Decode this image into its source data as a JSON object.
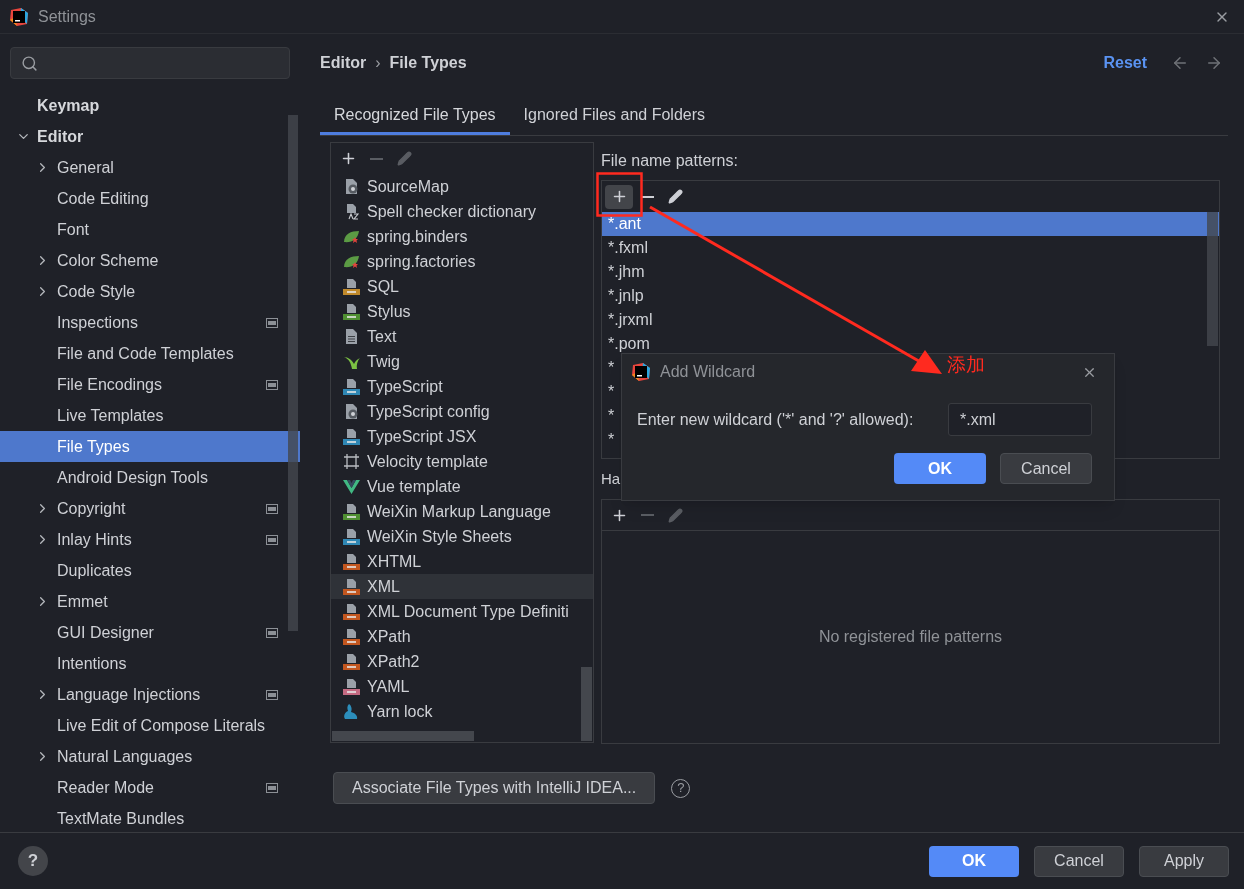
{
  "window": {
    "title": "Settings"
  },
  "sidebar": {
    "items": [
      {
        "label": "Keymap",
        "selected": false
      },
      {
        "label": "Editor",
        "selected": false,
        "expanded": true,
        "children": [
          {
            "label": "General",
            "expanded": false,
            "project": false,
            "selected": false
          },
          {
            "label": "Code Editing",
            "project": false,
            "selected": false
          },
          {
            "label": "Font",
            "project": false,
            "selected": false
          },
          {
            "label": "Color Scheme",
            "expanded": false,
            "project": false,
            "selected": false
          },
          {
            "label": "Code Style",
            "expanded": false,
            "project": false,
            "selected": false
          },
          {
            "label": "Inspections",
            "project": true,
            "selected": false
          },
          {
            "label": "File and Code Templates",
            "project": false,
            "selected": false
          },
          {
            "label": "File Encodings",
            "project": true,
            "selected": false
          },
          {
            "label": "Live Templates",
            "project": false,
            "selected": false
          },
          {
            "label": "File Types",
            "project": false,
            "selected": true
          },
          {
            "label": "Android Design Tools",
            "project": false,
            "selected": false
          },
          {
            "label": "Copyright",
            "expanded": false,
            "project": true,
            "selected": false
          },
          {
            "label": "Inlay Hints",
            "expanded": false,
            "project": true,
            "selected": false
          },
          {
            "label": "Duplicates",
            "project": false,
            "selected": false
          },
          {
            "label": "Emmet",
            "expanded": false,
            "project": false,
            "selected": false
          },
          {
            "label": "GUI Designer",
            "project": true,
            "selected": false
          },
          {
            "label": "Intentions",
            "project": false,
            "selected": false
          },
          {
            "label": "Language Injections",
            "expanded": false,
            "project": true,
            "selected": false
          },
          {
            "label": "Live Edit of Compose Literals",
            "project": false,
            "selected": false
          },
          {
            "label": "Natural Languages",
            "expanded": false,
            "project": false,
            "selected": false
          },
          {
            "label": "Reader Mode",
            "project": true,
            "selected": false
          },
          {
            "label": "TextMate Bundles",
            "project": false,
            "selected": false
          }
        ]
      }
    ]
  },
  "breadcrumb": {
    "items": [
      "Editor",
      "File Types"
    ],
    "separator": "›"
  },
  "reset": "Reset",
  "tabs": [
    {
      "label": "Recognized File Types",
      "selected": true
    },
    {
      "label": "Ignored Files and Folders",
      "selected": false
    }
  ],
  "file_types": {
    "toolbar": [
      {
        "kind": "add",
        "disabled": false
      },
      {
        "kind": "remove",
        "disabled": true
      },
      {
        "kind": "edit",
        "disabled": true
      }
    ],
    "items": [
      {
        "label": "SourceMap",
        "kind": "config",
        "selected": false
      },
      {
        "label": "Spell checker dictionary",
        "kind": "dictionary",
        "selected": false
      },
      {
        "label": "spring.binders",
        "kind": "leaf-gear",
        "selected": false
      },
      {
        "label": "spring.factories",
        "kind": "leaf-star",
        "selected": false
      },
      {
        "label": "SQL",
        "kind": "badge",
        "color": "#c0892b",
        "selected": false
      },
      {
        "label": "Stylus",
        "kind": "badge",
        "color": "#4f8f32",
        "selected": false
      },
      {
        "label": "Text",
        "kind": "text",
        "selected": false
      },
      {
        "label": "Twig",
        "kind": "twig",
        "selected": false
      },
      {
        "label": "TypeScript",
        "kind": "badge",
        "color": "#2f87b4",
        "selected": false
      },
      {
        "label": "TypeScript config",
        "kind": "config",
        "selected": false
      },
      {
        "label": "TypeScript JSX",
        "kind": "badge",
        "color": "#2f87b4",
        "selected": false
      },
      {
        "label": "Velocity template",
        "kind": "velocity",
        "selected": false
      },
      {
        "label": "Vue template",
        "kind": "vue",
        "selected": false
      },
      {
        "label": "WeiXin Markup Language",
        "kind": "badge",
        "color": "#4f8f32",
        "selected": false
      },
      {
        "label": "WeiXin Style Sheets",
        "kind": "badge",
        "color": "#2f87b4",
        "selected": false
      },
      {
        "label": "XHTML",
        "kind": "badge",
        "color": "#c2561f",
        "selected": false
      },
      {
        "label": "XML",
        "kind": "badge",
        "color": "#c2561f",
        "selected": true
      },
      {
        "label": "XML Document Type Definiti",
        "kind": "badge",
        "color": "#c2561f",
        "selected": false
      },
      {
        "label": "XPath",
        "kind": "badge",
        "color": "#c2561f",
        "selected": false
      },
      {
        "label": "XPath2",
        "kind": "badge",
        "color": "#c2561f",
        "selected": false
      },
      {
        "label": "YAML",
        "kind": "badge",
        "color": "#c46a82",
        "selected": false
      },
      {
        "label": "Yarn lock",
        "kind": "yarn",
        "selected": false
      }
    ]
  },
  "patterns": {
    "label": "File name patterns:",
    "toolbar": [
      {
        "kind": "add",
        "disabled": false,
        "highlighted": true
      },
      {
        "kind": "remove",
        "disabled": false,
        "highlighted": false
      },
      {
        "kind": "edit",
        "disabled": false,
        "highlighted": false
      }
    ],
    "items": [
      {
        "text": "*.ant",
        "selected": true
      },
      {
        "text": "*.fxml",
        "selected": false
      },
      {
        "text": "*.jhm",
        "selected": false
      },
      {
        "text": "*.jnlp",
        "selected": false
      },
      {
        "text": "*.jrxml",
        "selected": false
      },
      {
        "text": "*.pom",
        "selected": false
      },
      {
        "text": "*",
        "selected": false
      },
      {
        "text": "*",
        "selected": false
      },
      {
        "text": "*",
        "selected": false
      },
      {
        "text": "*",
        "selected": false
      }
    ]
  },
  "hashbang": {
    "label": "Ha",
    "toolbar": [
      {
        "kind": "add",
        "disabled": false
      },
      {
        "kind": "remove",
        "disabled": true
      },
      {
        "kind": "edit",
        "disabled": true
      }
    ],
    "empty_text": "No registered file patterns"
  },
  "associate_button": "Associate File Types with IntelliJ IDEA...",
  "associate_help": "?",
  "dialog": {
    "title": "Add Wildcard",
    "prompt": "Enter new wildcard ('*' and '?' allowed):",
    "value": "*.xml",
    "buttons": [
      {
        "label": "OK",
        "primary": true
      },
      {
        "label": "Cancel",
        "primary": false
      }
    ]
  },
  "annotation": {
    "label": "添加"
  },
  "footer": {
    "help": "?",
    "buttons": [
      {
        "label": "OK",
        "primary": true
      },
      {
        "label": "Cancel",
        "primary": false
      },
      {
        "label": "Apply",
        "primary": false
      }
    ]
  }
}
